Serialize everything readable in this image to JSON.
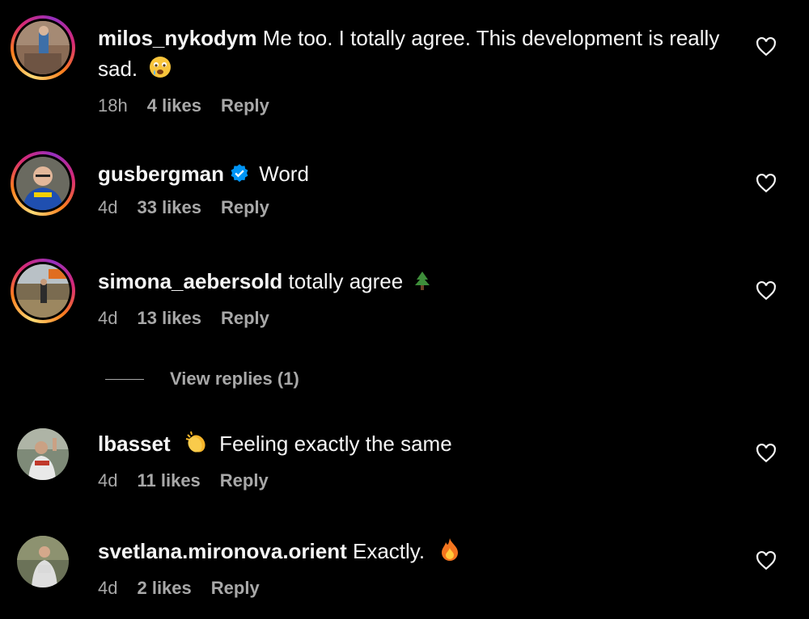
{
  "comments": [
    {
      "username": "milos_nykodym",
      "text": "Me too. I totally agree. This development is really sad.",
      "emoji": "sad-face",
      "time": "18h",
      "likes": "4 likes",
      "reply": "Reply",
      "verified": false,
      "story_ring": true
    },
    {
      "username": "gusbergman",
      "text": "Word",
      "emoji": "",
      "time": "4d",
      "likes": "33 likes",
      "reply": "Reply",
      "verified": true,
      "story_ring": true
    },
    {
      "username": "simona_aebersold",
      "text": "totally agree",
      "emoji": "tree",
      "time": "4d",
      "likes": "13 likes",
      "reply": "Reply",
      "verified": false,
      "story_ring": true
    },
    {
      "username": "lbasset",
      "text": "Feeling exactly the same",
      "emoji": "clap",
      "time": "4d",
      "likes": "11 likes",
      "reply": "Reply",
      "verified": false,
      "story_ring": false
    },
    {
      "username": "svetlana.mironova.orient",
      "text": "Exactly.",
      "emoji": "fire",
      "time": "4d",
      "likes": "2 likes",
      "reply": "Reply",
      "verified": false,
      "story_ring": false
    }
  ],
  "view_replies": "View replies (1)",
  "colors": {
    "background": "#000000",
    "text": "#f5f5f5",
    "muted": "#a8a8a8",
    "verified": "#0095f6"
  }
}
